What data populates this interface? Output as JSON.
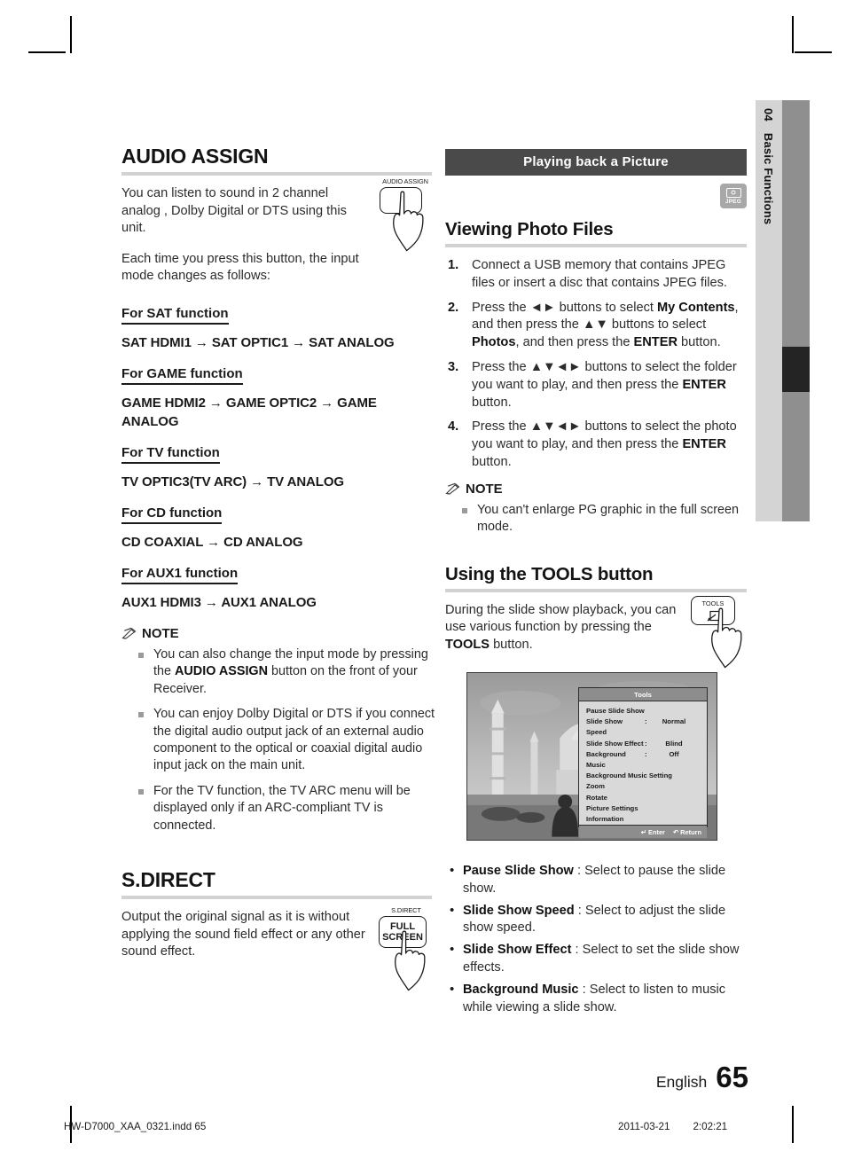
{
  "left_column": {
    "audio_assign": {
      "heading": "AUDIO ASSIGN",
      "intro_1": "You can listen to sound in 2 channel analog , Dolby Digital or DTS using this unit.",
      "intro_2": "Each time you press this button, the input mode changes as follows:",
      "button_illustration": {
        "caption": "AUDIO ASSIGN"
      },
      "functions": [
        {
          "head": "For SAT function",
          "sequence": "SAT HDMI1 → SAT OPTIC1 → SAT ANALOG"
        },
        {
          "head": "For GAME function",
          "sequence": "GAME HDMI2 → GAME OPTIC2 → GAME ANALOG"
        },
        {
          "head": "For TV function",
          "sequence": "TV OPTIC3(TV ARC) → TV ANALOG"
        },
        {
          "head": "For CD function",
          "sequence": "CD COAXIAL → CD ANALOG"
        },
        {
          "head": "For AUX1 function",
          "sequence": "AUX1 HDMI3 → AUX1 ANALOG"
        }
      ],
      "note": {
        "label": "NOTE",
        "items": [
          "You can also change the input mode by pressing the <b>AUDIO ASSIGN</b> button on the front of your Receiver.",
          "You can enjoy Dolby Digital or DTS if you connect the digital audio output jack of an external audio component to the optical or coaxial digital audio input jack on the main unit.",
          "For the TV function, the TV ARC menu will be displayed only if an ARC-compliant TV is connected."
        ]
      }
    },
    "s_direct": {
      "heading": "S.DIRECT",
      "body": "Output the original signal as it is without applying the sound field effect or any other sound effect.",
      "button_illustration": {
        "caption": "S.DIRECT",
        "line1": "FULL",
        "line2": "SCREEN"
      }
    }
  },
  "right_column": {
    "banner": "Playing back a Picture",
    "badge": {
      "label": "JPEG",
      "icon": "camera-icon"
    },
    "viewing_photo_files": {
      "heading": "Viewing Photo Files",
      "steps": [
        {
          "num": "1.",
          "text": "Connect a USB memory that contains JPEG files or insert a disc that contains JPEG files."
        },
        {
          "num": "2.",
          "text": "Press the ◄► buttons to select <b>My Contents</b>, and then press the ▲▼ buttons to select <b>Photos</b>, and then press the <b>ENTER</b> button."
        },
        {
          "num": "3.",
          "text": "Press the ▲▼◄► buttons to select the folder you want to play, and then press the <b>ENTER</b> button."
        },
        {
          "num": "4.",
          "text": "Press the ▲▼◄► buttons to select the photo you want to play, and then press the <b>ENTER</b> button."
        }
      ],
      "note": {
        "label": "NOTE",
        "items": [
          "You can't enlarge PG graphic in the full screen mode."
        ]
      }
    },
    "tools_section": {
      "heading": "Using the TOOLS button",
      "body": "During the slide show playback, you can use various function by pressing the <b>TOOLS</b> button.",
      "button_illustration": {
        "caption": "",
        "label": "TOOLS"
      },
      "osd": {
        "title": "Tools",
        "rows": [
          {
            "name": "Pause Slide Show",
            "colon": "",
            "value": ""
          },
          {
            "name": "Slide Show Speed",
            "colon": ":",
            "value": "Normal"
          },
          {
            "name": "Slide Show Effect",
            "colon": ":",
            "value": "Blind"
          },
          {
            "name": "Background Music",
            "colon": ":",
            "value": "Off"
          },
          {
            "name": "Background Music Setting",
            "colon": "",
            "value": ""
          },
          {
            "name": "Zoom",
            "colon": "",
            "value": ""
          },
          {
            "name": "Rotate",
            "colon": "",
            "value": ""
          },
          {
            "name": "Picture Settings",
            "colon": "",
            "value": ""
          },
          {
            "name": "Information",
            "colon": "",
            "value": ""
          }
        ],
        "footer": {
          "enter": "↵ Enter",
          "return": "↶ Return"
        }
      },
      "descriptions": [
        {
          "term": "Pause Slide Show",
          "text": " : Select to pause the slide show."
        },
        {
          "term": "Slide Show Speed",
          "text": " : Select to adjust the slide show speed."
        },
        {
          "term": "Slide Show Effect",
          "text": " : Select to set the slide show effects."
        },
        {
          "term": "Background Music",
          "text": " : Select to listen to music while viewing a slide show."
        }
      ]
    }
  },
  "side_tab": {
    "chapter_number": "04",
    "chapter_title": "Basic Functions"
  },
  "footer": {
    "language": "English",
    "page_number": "65",
    "slug": "HW-D7000_XAA_0321.indd   65",
    "date": "2011-03-21",
    "time": "2:02:21"
  }
}
